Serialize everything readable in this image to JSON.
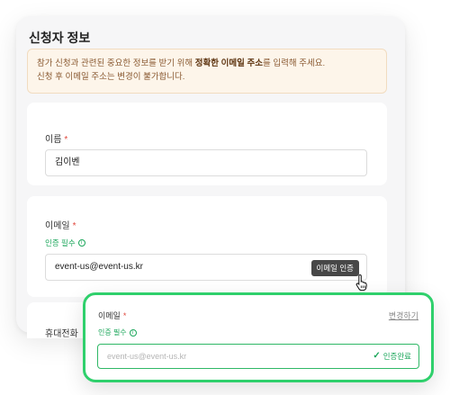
{
  "form": {
    "title": "신청자 정보",
    "notice": {
      "line1_prefix": "참가 신청과 관련된 중요한 정보를 받기 위해 ",
      "line1_bold": "정확한 이메일 주소",
      "line1_suffix": "를 입력해 주세요.",
      "line2": "신청 후 이메일 주소는 변경이 불가합니다."
    },
    "name": {
      "label": "이름",
      "required_mark": "*",
      "value": "김이벤"
    },
    "email": {
      "label": "이메일",
      "required_mark": "*",
      "verify_required": "인증 필수",
      "info_glyph": "i",
      "value": "event-us@event-us.kr",
      "verify_button": "이메일 인증"
    },
    "phone": {
      "label_partial": "휴대전화"
    }
  },
  "overlay": {
    "label": "이메일",
    "required_mark": "*",
    "change_link": "변경하기",
    "verify_required": "인증 필수",
    "info_glyph": "i",
    "placeholder": "event-us@event-us.kr",
    "done_glyph": "✓",
    "done_text": "인증완료"
  },
  "colors": {
    "accent_green": "#2fd06c",
    "status_green": "#1aa65a",
    "required_red": "#e0473c",
    "notice_bg": "#fdf5ea"
  },
  "icons": {
    "cursor": "hand-pointer-icon",
    "info": "info-circle-icon",
    "check": "check-icon"
  }
}
